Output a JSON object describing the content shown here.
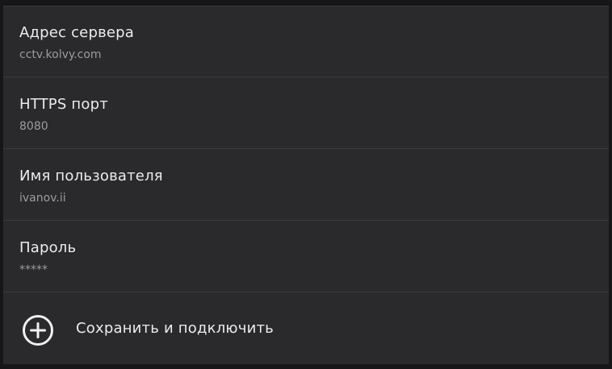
{
  "settings": {
    "items": [
      {
        "label": "Адрес сервера",
        "value": "cctv.kolvy.com"
      },
      {
        "label": "HTTPS порт",
        "value": "8080"
      },
      {
        "label": "Имя пользователя",
        "value": "ivanov.ii"
      },
      {
        "label": "Пароль",
        "value": "*****"
      }
    ],
    "action": {
      "label": "Сохранить и подключить",
      "icon": "add-circle-icon"
    }
  },
  "colors": {
    "background": "#2a2a2c",
    "text_primary": "#ececec",
    "text_secondary": "#9c9c9f",
    "divider": "#3b3b3e"
  }
}
